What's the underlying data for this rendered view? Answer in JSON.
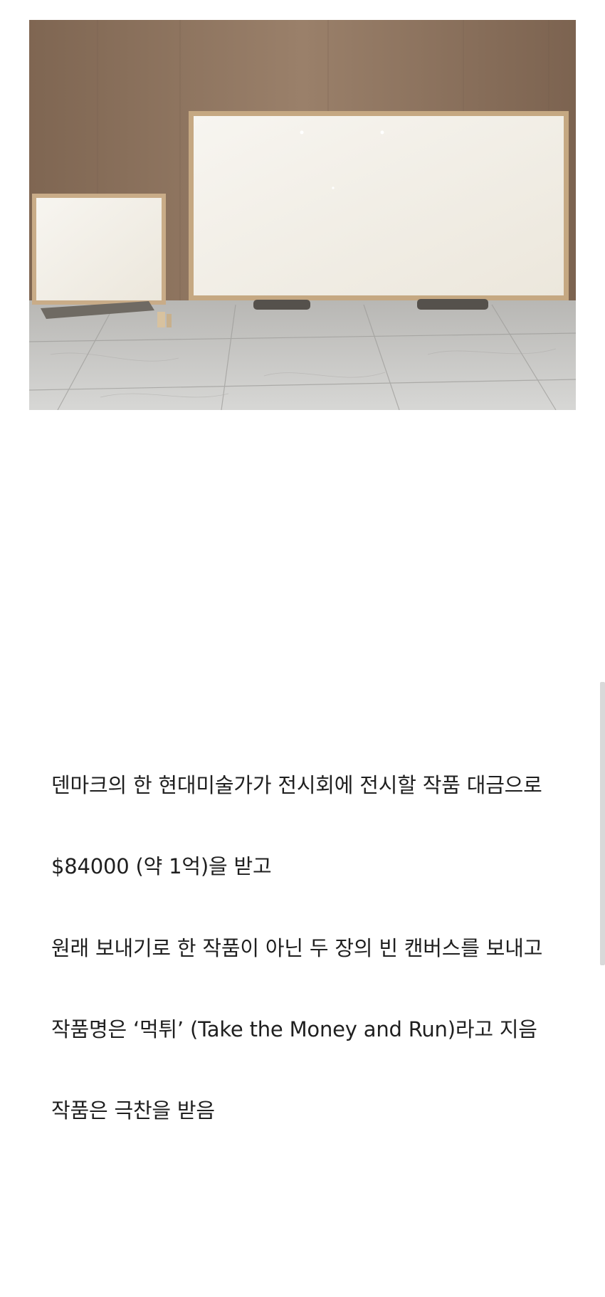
{
  "image": {
    "alt": "",
    "colors": {
      "wall": "#8e7660",
      "floor": "#c9c9c7",
      "canvas": "#f2efe8",
      "frame": "#c7aa86"
    }
  },
  "article": {
    "paragraphs": [
      "덴마크의 한 현대미술가가 전시회에 전시할 작품 대금으로",
      "$84000 (약 1억)을 받고",
      "원래 보내기로 한 작품이 아닌 두 장의 빈 캔버스를 보내고",
      "작품명은 ‘먹튀’ (Take the Money and Run)라고 지음",
      "작품은 극찬을 받음"
    ]
  }
}
